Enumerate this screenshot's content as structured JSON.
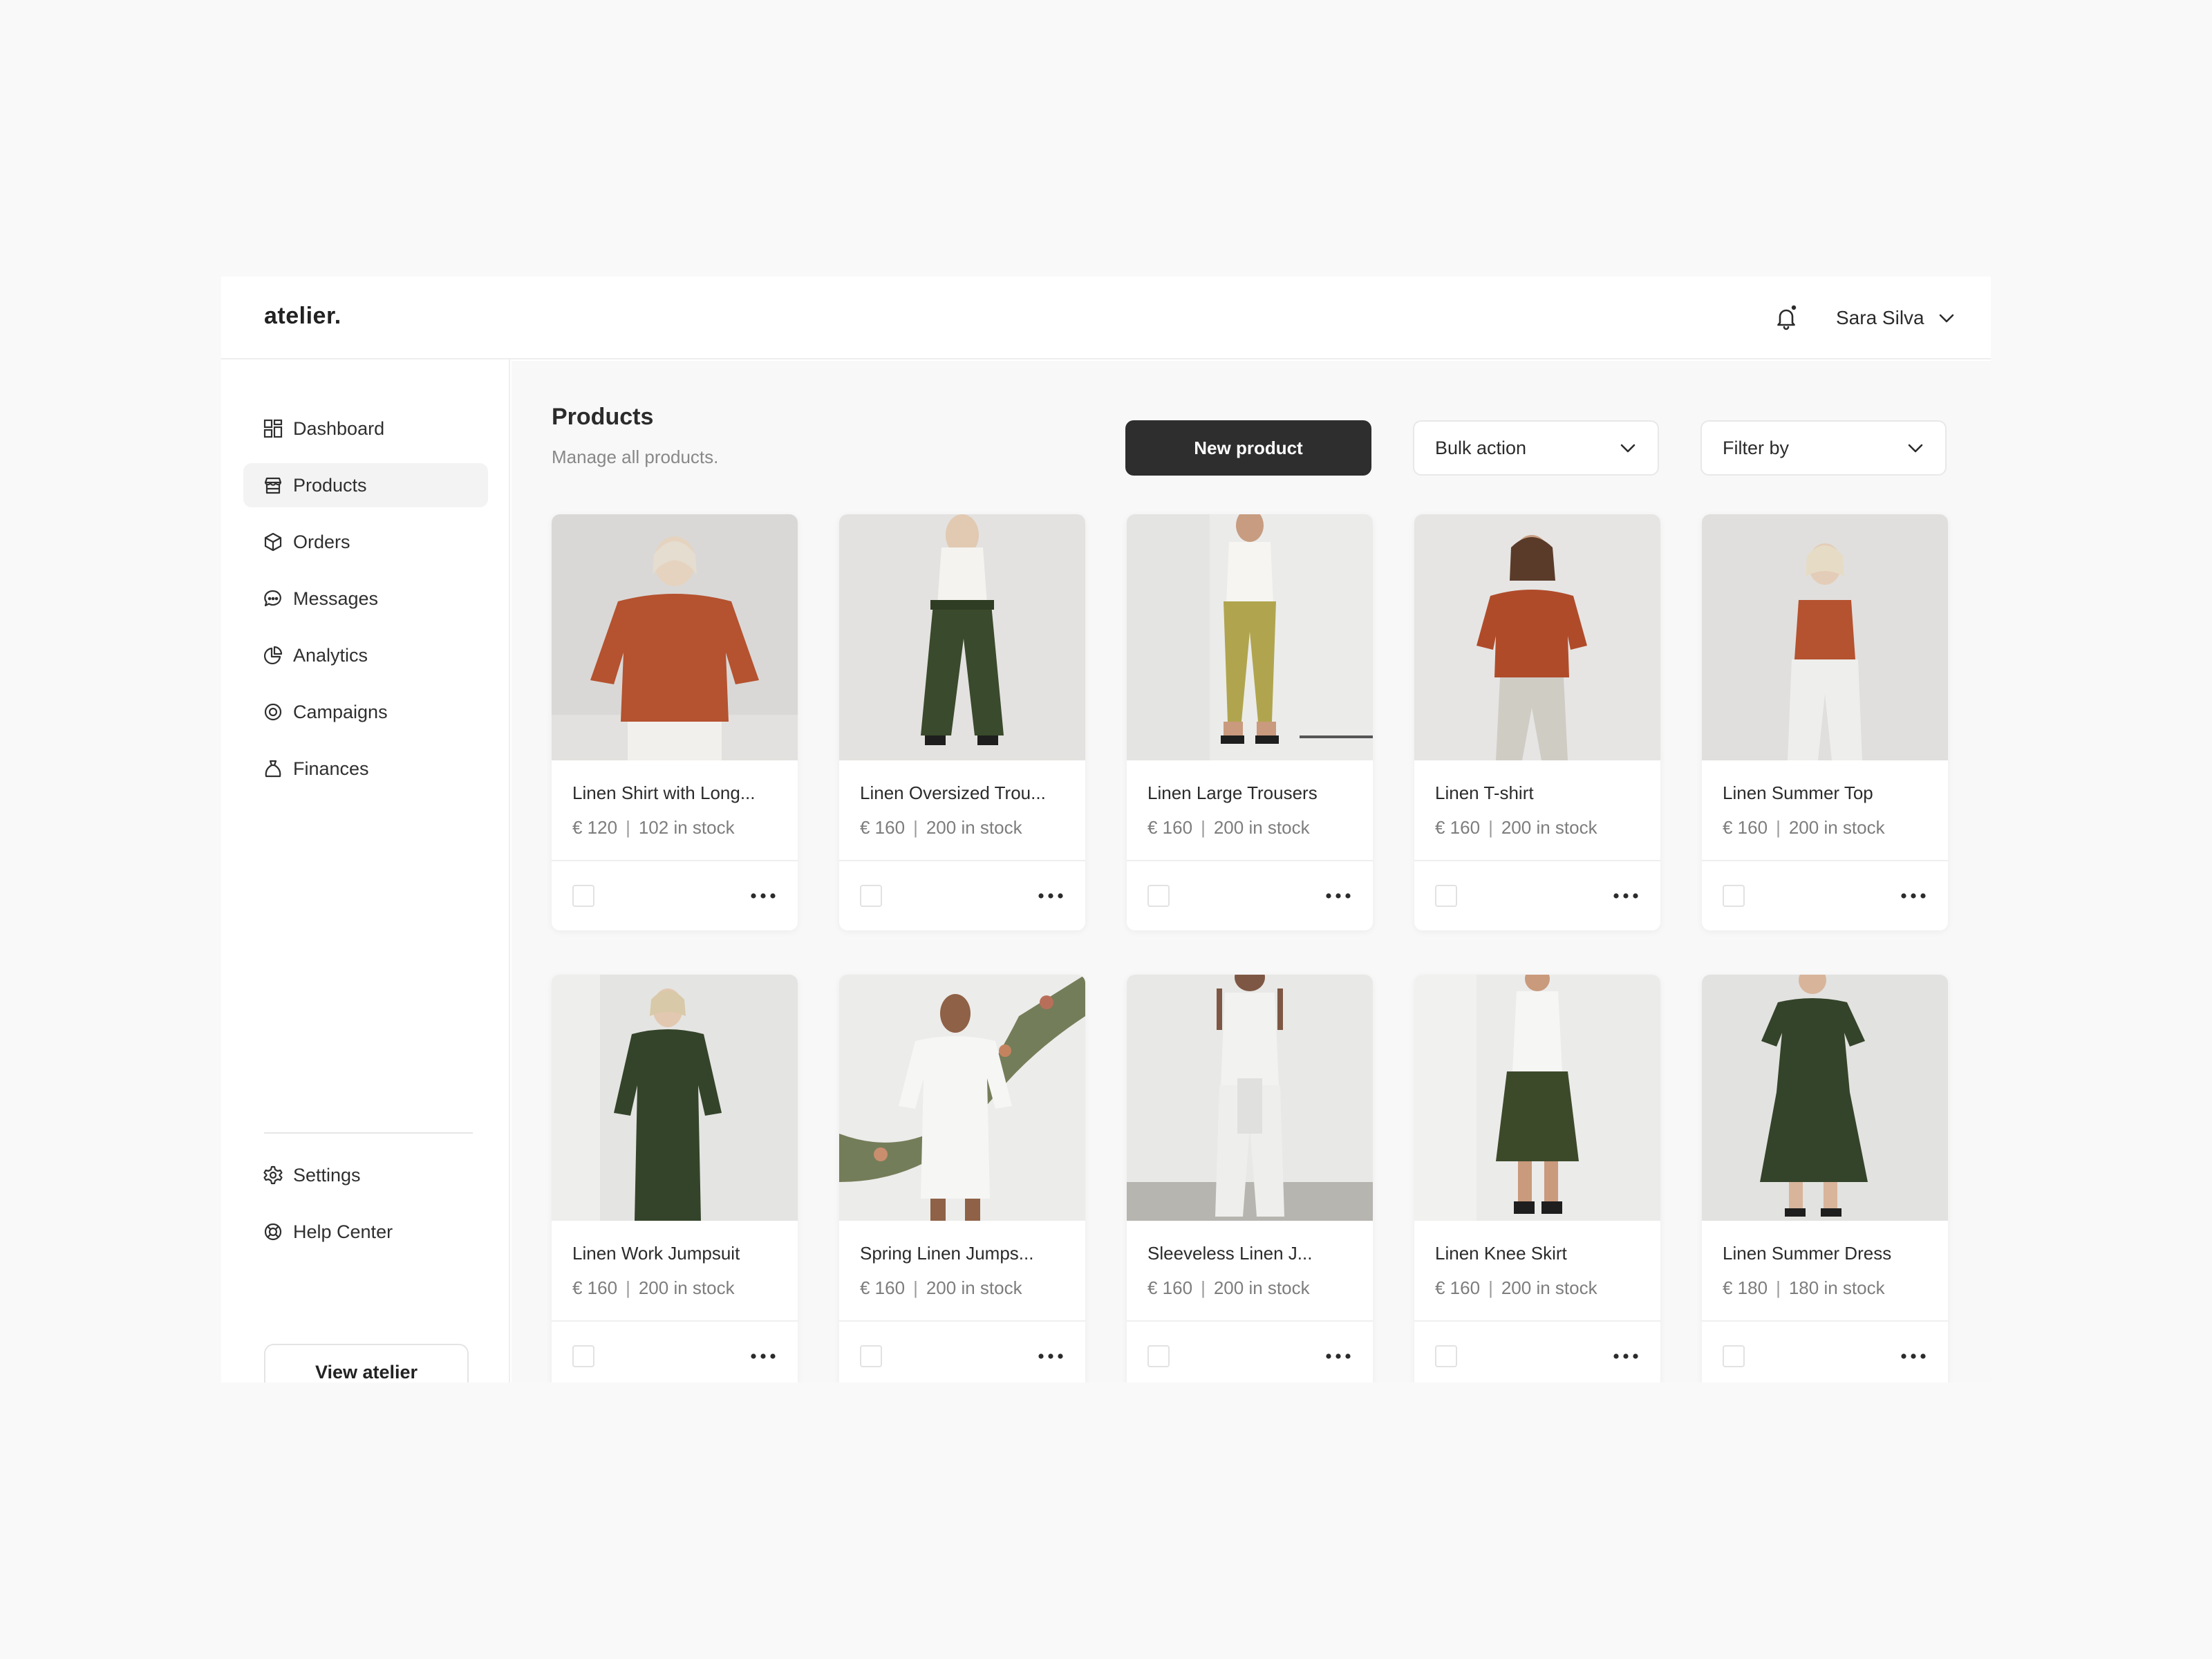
{
  "header": {
    "logo": "atelier.",
    "user_name": "Sara Silva"
  },
  "sidebar": {
    "items": [
      {
        "label": "Dashboard",
        "icon": "grid-icon"
      },
      {
        "label": "Products",
        "icon": "store-icon",
        "active": true
      },
      {
        "label": "Orders",
        "icon": "box-icon"
      },
      {
        "label": "Messages",
        "icon": "chat-icon"
      },
      {
        "label": "Analytics",
        "icon": "pie-chart-icon"
      },
      {
        "label": "Campaigns",
        "icon": "target-icon"
      },
      {
        "label": "Finances",
        "icon": "money-bag-icon"
      }
    ],
    "bottom_items": [
      {
        "label": "Settings",
        "icon": "gear-icon"
      },
      {
        "label": "Help Center",
        "icon": "lifebuoy-icon"
      }
    ],
    "view_button": "View atelier"
  },
  "main": {
    "title": "Products",
    "subtitle": "Manage all products.",
    "new_product_label": "New product",
    "bulk_action_label": "Bulk action",
    "filter_label": "Filter by"
  },
  "products": [
    {
      "name": "Linen Shirt with Long...",
      "price": "€ 120",
      "stock": "102 in stock"
    },
    {
      "name": "Linen Oversized Trou...",
      "price": "€ 160",
      "stock": "200 in stock"
    },
    {
      "name": "Linen Large Trousers",
      "price": "€ 160",
      "stock": "200 in stock"
    },
    {
      "name": "Linen T-shirt",
      "price": "€ 160",
      "stock": "200 in stock"
    },
    {
      "name": "Linen Summer Top",
      "price": "€ 160",
      "stock": "200 in stock"
    },
    {
      "name": "Linen Work Jumpsuit",
      "price": "€ 160",
      "stock": "200 in stock"
    },
    {
      "name": "Spring Linen Jumps...",
      "price": "€ 160",
      "stock": "200 in stock"
    },
    {
      "name": "Sleeveless Linen J...",
      "price": "€ 160",
      "stock": "200 in stock"
    },
    {
      "name": "Linen Knee Skirt",
      "price": "€ 160",
      "stock": "200 in stock"
    },
    {
      "name": "Linen Summer Dress",
      "price": "€ 180",
      "stock": "180 in stock"
    }
  ],
  "product_photo_colors": {
    "top_rust": "#b5522f",
    "olive_green": "#3c4a2a",
    "mustard": "#b0a54e",
    "linen_white": "#eeeeec",
    "light_grey": "#c9c6bf"
  }
}
